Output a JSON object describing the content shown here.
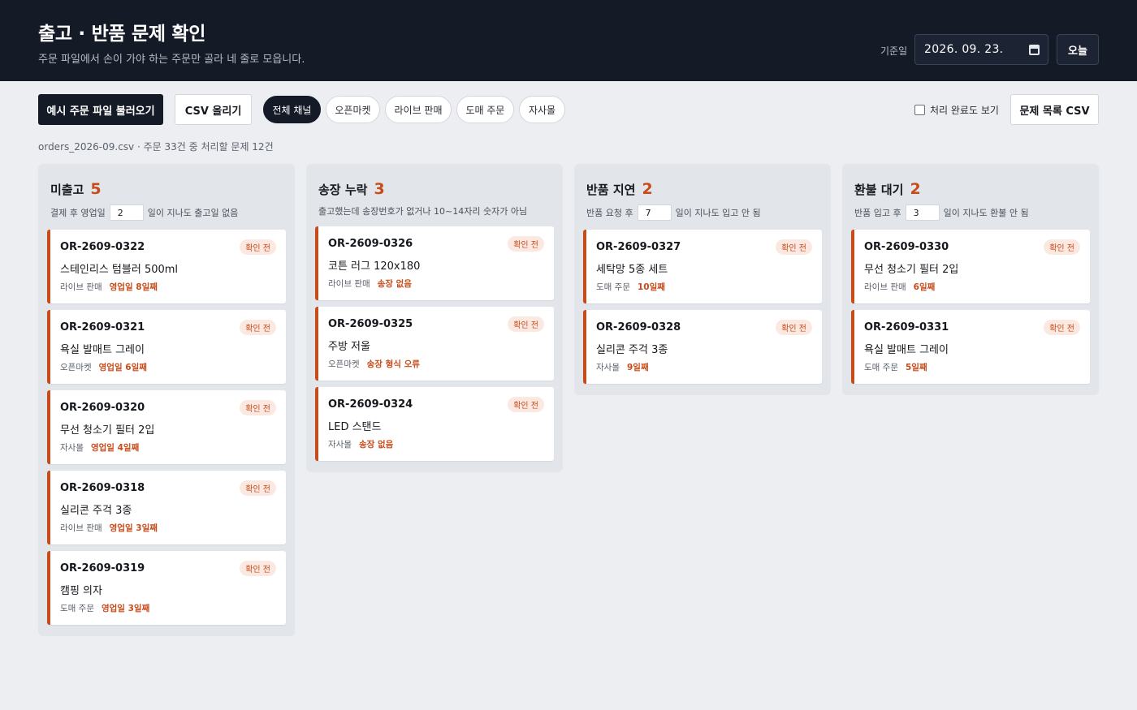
{
  "header": {
    "title": "출고 · 반품 문제 확인",
    "subtitle": "주문 파일에서 손이 가야 하는 주문만 골라 네 줄로 모읍니다.",
    "date_label": "기준일",
    "date_value": "2026. 09. 23.",
    "today_label": "오늘"
  },
  "toolbar": {
    "load_sample_label": "예시 주문 파일 불러오기",
    "upload_csv_label": "CSV 올리기",
    "channels": [
      "전체 채널",
      "오픈마켓",
      "라이브 판매",
      "도매 주문",
      "자사몰"
    ],
    "active_channel": "전체 채널",
    "show_done_label": "처리 완료도 보기",
    "export_label": "문제 목록 CSV"
  },
  "file_info": "orders_2026-09.csv · 주문 33건 중 처리할 문제 12건",
  "columns": [
    {
      "title": "미출고",
      "count": "5",
      "desc_before": "결제 후 영업일",
      "threshold": "2",
      "desc_after": "일이 지나도 출고일 없음",
      "cards": [
        {
          "id": "OR-2609-0322",
          "product": "스테인리스 텀블러 500ml",
          "channel": "라이브 판매",
          "issue": "영업일 8일째",
          "status": "확인 전"
        },
        {
          "id": "OR-2609-0321",
          "product": "욕실 발매트 그레이",
          "channel": "오픈마켓",
          "issue": "영업일 6일째",
          "status": "확인 전"
        },
        {
          "id": "OR-2609-0320",
          "product": "무선 청소기 필터 2입",
          "channel": "자사몰",
          "issue": "영업일 4일째",
          "status": "확인 전"
        },
        {
          "id": "OR-2609-0318",
          "product": "실리콘 주걱 3종",
          "channel": "라이브 판매",
          "issue": "영업일 3일째",
          "status": "확인 전"
        },
        {
          "id": "OR-2609-0319",
          "product": "캠핑 의자",
          "channel": "도매 주문",
          "issue": "영업일 3일째",
          "status": "확인 전"
        }
      ]
    },
    {
      "title": "송장 누락",
      "count": "3",
      "desc_before": "출고했는데 송장번호가 없거나 10~14자리 숫자가 아님",
      "threshold": "",
      "desc_after": "",
      "cards": [
        {
          "id": "OR-2609-0326",
          "product": "코튼 러그 120x180",
          "channel": "라이브 판매",
          "issue": "송장 없음",
          "status": "확인 전"
        },
        {
          "id": "OR-2609-0325",
          "product": "주방 저울",
          "channel": "오픈마켓",
          "issue": "송장 형식 오류",
          "status": "확인 전"
        },
        {
          "id": "OR-2609-0324",
          "product": "LED 스탠드",
          "channel": "자사몰",
          "issue": "송장 없음",
          "status": "확인 전"
        }
      ]
    },
    {
      "title": "반품 지연",
      "count": "2",
      "desc_before": "반품 요청 후",
      "threshold": "7",
      "desc_after": "일이 지나도 입고 안 됨",
      "cards": [
        {
          "id": "OR-2609-0327",
          "product": "세탁망 5종 세트",
          "channel": "도매 주문",
          "issue": "10일째",
          "status": "확인 전"
        },
        {
          "id": "OR-2609-0328",
          "product": "실리콘 주걱 3종",
          "channel": "자사몰",
          "issue": "9일째",
          "status": "확인 전"
        }
      ]
    },
    {
      "title": "환불 대기",
      "count": "2",
      "desc_before": "반품 입고 후",
      "threshold": "3",
      "desc_after": "일이 지나도 환불 안 됨",
      "cards": [
        {
          "id": "OR-2609-0330",
          "product": "무선 청소기 필터 2입",
          "channel": "라이브 판매",
          "issue": "6일째",
          "status": "확인 전"
        },
        {
          "id": "OR-2609-0331",
          "product": "욕실 발매트 그레이",
          "channel": "도매 주문",
          "issue": "5일째",
          "status": "확인 전"
        }
      ]
    }
  ]
}
